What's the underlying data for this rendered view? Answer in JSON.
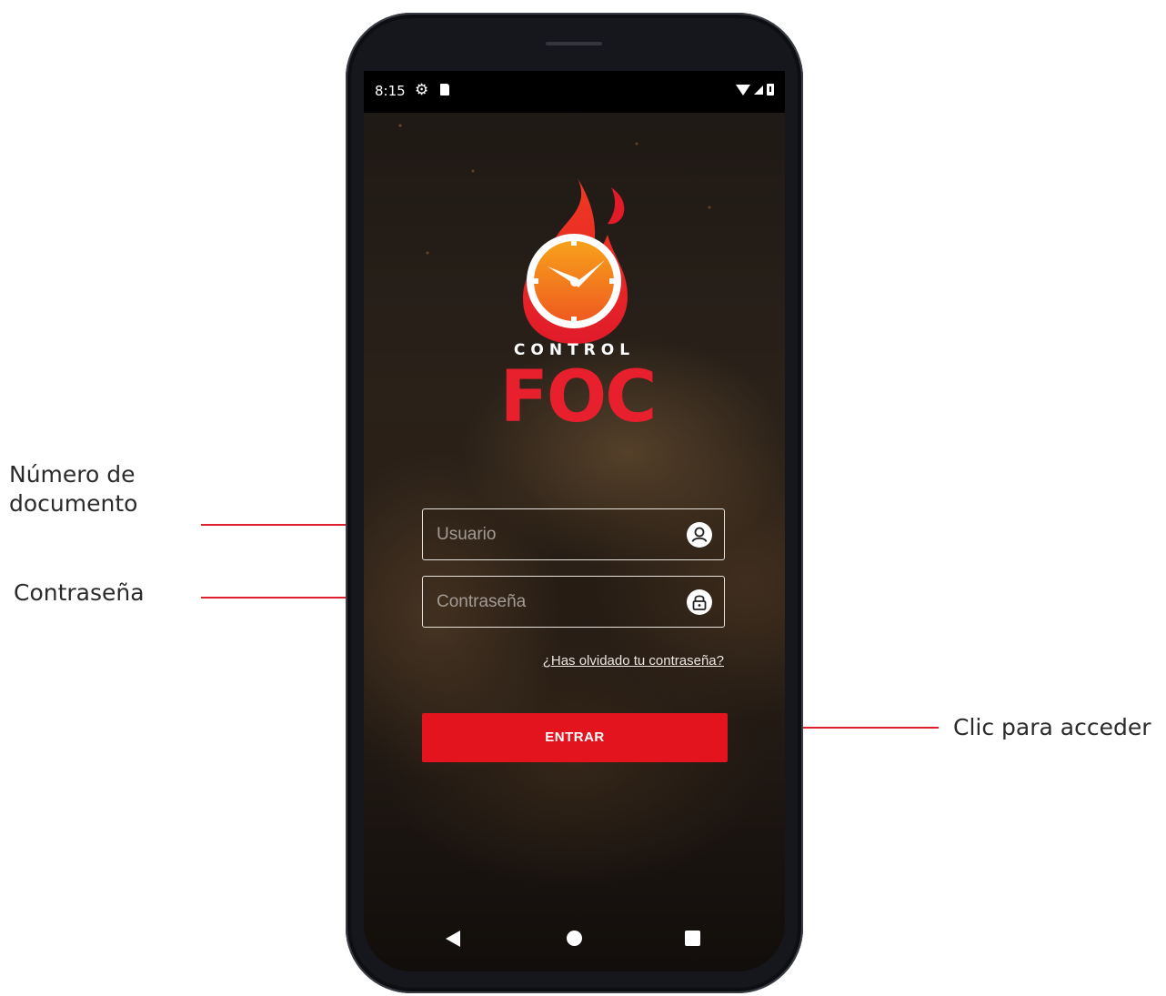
{
  "annotations": {
    "user_field": "Número de\ndocumento",
    "password_field": "Contraseña",
    "enter_button": "Clic para acceder"
  },
  "status_bar": {
    "time": "8:15",
    "icons": [
      "gear-icon",
      "sd-card-icon",
      "wifi-icon",
      "signal-icon",
      "battery-icon"
    ]
  },
  "logo": {
    "line1": "CONTROL",
    "line2": "FOC"
  },
  "form": {
    "username_placeholder": "Usuario",
    "username_icon": "user-icon",
    "password_placeholder": "Contraseña",
    "password_icon": "lock-icon",
    "forgot_link": "¿Has olvidado tu contraseña?",
    "submit_label": "ENTRAR"
  },
  "nav_bar": {
    "icons": [
      "back-icon",
      "home-icon",
      "recents-icon"
    ]
  },
  "colors": {
    "accent": "#e3141e",
    "annotation_line": "#e0202c",
    "logo_red": "#e8202d",
    "flame_orange": "#f26a1b"
  }
}
